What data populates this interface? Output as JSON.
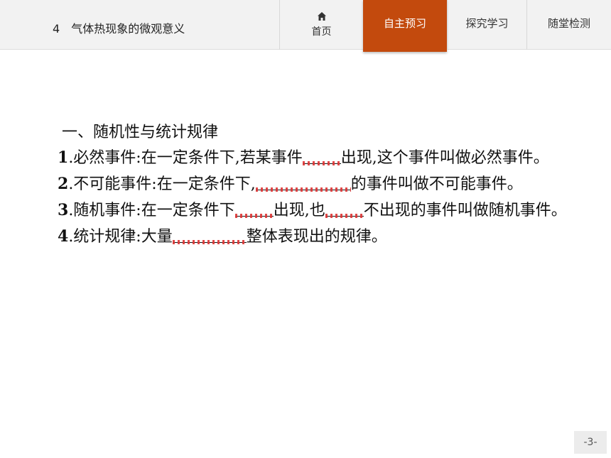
{
  "header": {
    "lesson_number": "4",
    "lesson_title": "气体热现象的微观意义",
    "nav": {
      "home_label": "首页",
      "preview_label": "自主预习",
      "explore_label": "探究学习",
      "quiz_label": "随堂检测"
    },
    "active_tab_color": "#c34a0d"
  },
  "content": {
    "heading": "一、随机性与统计规律",
    "items": [
      {
        "num": "1",
        "before": ".必然事件:在一定条件下,若某事件",
        "after": "出现,这个事件叫做必然事件。"
      },
      {
        "num": "2",
        "before": ".不可能事件:在一定条件下,",
        "after": "的事件叫做不可能事件。"
      },
      {
        "num": "3",
        "before": ".随机事件:在一定条件下",
        "middle": "出现,也",
        "after": "不出现的事件叫做随机事件。"
      },
      {
        "num": "4",
        "before": ".统计规律:大量",
        "after": "整体表现出的规律。"
      }
    ]
  },
  "footer": {
    "page_number": "-3-"
  }
}
